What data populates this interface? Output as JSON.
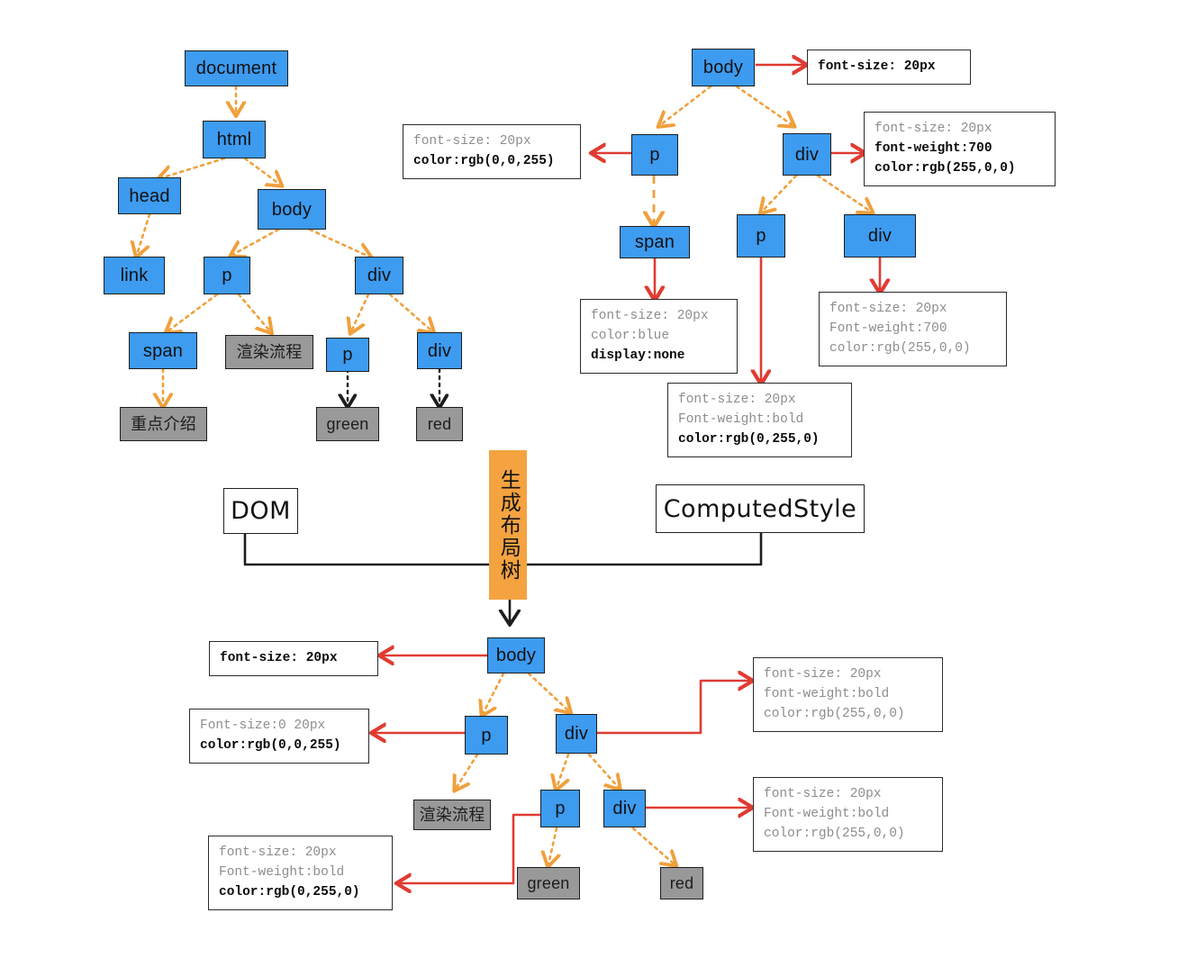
{
  "colors": {
    "element_node": "#3d9bf0",
    "text_node": "#999999",
    "process_box": "#f4a340",
    "dom_edge": "#f0a03c",
    "style_edge": "#e03b32",
    "text_edge": "#1d1d1d"
  },
  "dom_tree": {
    "caption": "DOM",
    "nodes": {
      "document": "document",
      "html": "html",
      "head": "head",
      "body": "body",
      "link": "link",
      "p": "p",
      "div": "div",
      "span": "span",
      "text_render_flow": "渲染流程",
      "inner_p": "p",
      "inner_div": "div",
      "text_key_intro": "重点介绍",
      "text_green": "green",
      "text_red": "red"
    }
  },
  "computed_style_tree": {
    "caption": "ComputedStyle",
    "nodes": {
      "body": "body",
      "p": "p",
      "div": "div",
      "span": "span",
      "inner_p": "p",
      "inner_div": "div"
    },
    "style_boxes": {
      "body": [
        {
          "text": "font-size: 20px",
          "kind": "own"
        }
      ],
      "p": [
        {
          "text": "font-size: 20px",
          "kind": "inherit"
        },
        {
          "text": "color:rgb(0,0,255)",
          "kind": "own"
        }
      ],
      "div": [
        {
          "text": "font-size: 20px",
          "kind": "inherit"
        },
        {
          "text": "font-weight:700",
          "kind": "own"
        },
        {
          "text": "color:rgb(255,0,0)",
          "kind": "own"
        }
      ],
      "span": [
        {
          "text": "font-size: 20px",
          "kind": "inherit"
        },
        {
          "text": "color:blue",
          "kind": "inherit"
        },
        {
          "text": "display:none",
          "kind": "own"
        }
      ],
      "inner_p": [
        {
          "text": "font-size: 20px",
          "kind": "inherit"
        },
        {
          "text": "Font-weight:bold",
          "kind": "inherit"
        },
        {
          "text": "color:rgb(0,255,0)",
          "kind": "own"
        }
      ],
      "inner_div": [
        {
          "text": "font-size: 20px",
          "kind": "inherit"
        },
        {
          "text": "Font-weight:700",
          "kind": "inherit"
        },
        {
          "text": "color:rgb(255,0,0)",
          "kind": "inherit"
        }
      ]
    }
  },
  "process": {
    "label": "生成布局树"
  },
  "layout_tree": {
    "nodes": {
      "body": "body",
      "p": "p",
      "div": "div",
      "inner_p": "p",
      "inner_div": "div",
      "text_render_flow": "渲染流程",
      "text_green": "green",
      "text_red": "red"
    },
    "style_boxes": {
      "body": [
        {
          "text": "font-size: 20px",
          "kind": "own"
        }
      ],
      "p": [
        {
          "text": "Font-size:0 20px",
          "kind": "inherit"
        },
        {
          "text": "color:rgb(0,0,255)",
          "kind": "own"
        }
      ],
      "div": [
        {
          "text": "font-size: 20px",
          "kind": "inherit"
        },
        {
          "text": "font-weight:bold",
          "kind": "inherit"
        },
        {
          "text": "color:rgb(255,0,0)",
          "kind": "inherit"
        }
      ],
      "inner_div": [
        {
          "text": "font-size: 20px",
          "kind": "inherit"
        },
        {
          "text": "Font-weight:bold",
          "kind": "inherit"
        },
        {
          "text": "color:rgb(255,0,0)",
          "kind": "inherit"
        }
      ],
      "inner_p": [
        {
          "text": "font-size: 20px",
          "kind": "inherit"
        },
        {
          "text": "Font-weight:bold",
          "kind": "inherit"
        },
        {
          "text": "color:rgb(0,255,0)",
          "kind": "own"
        }
      ]
    }
  }
}
